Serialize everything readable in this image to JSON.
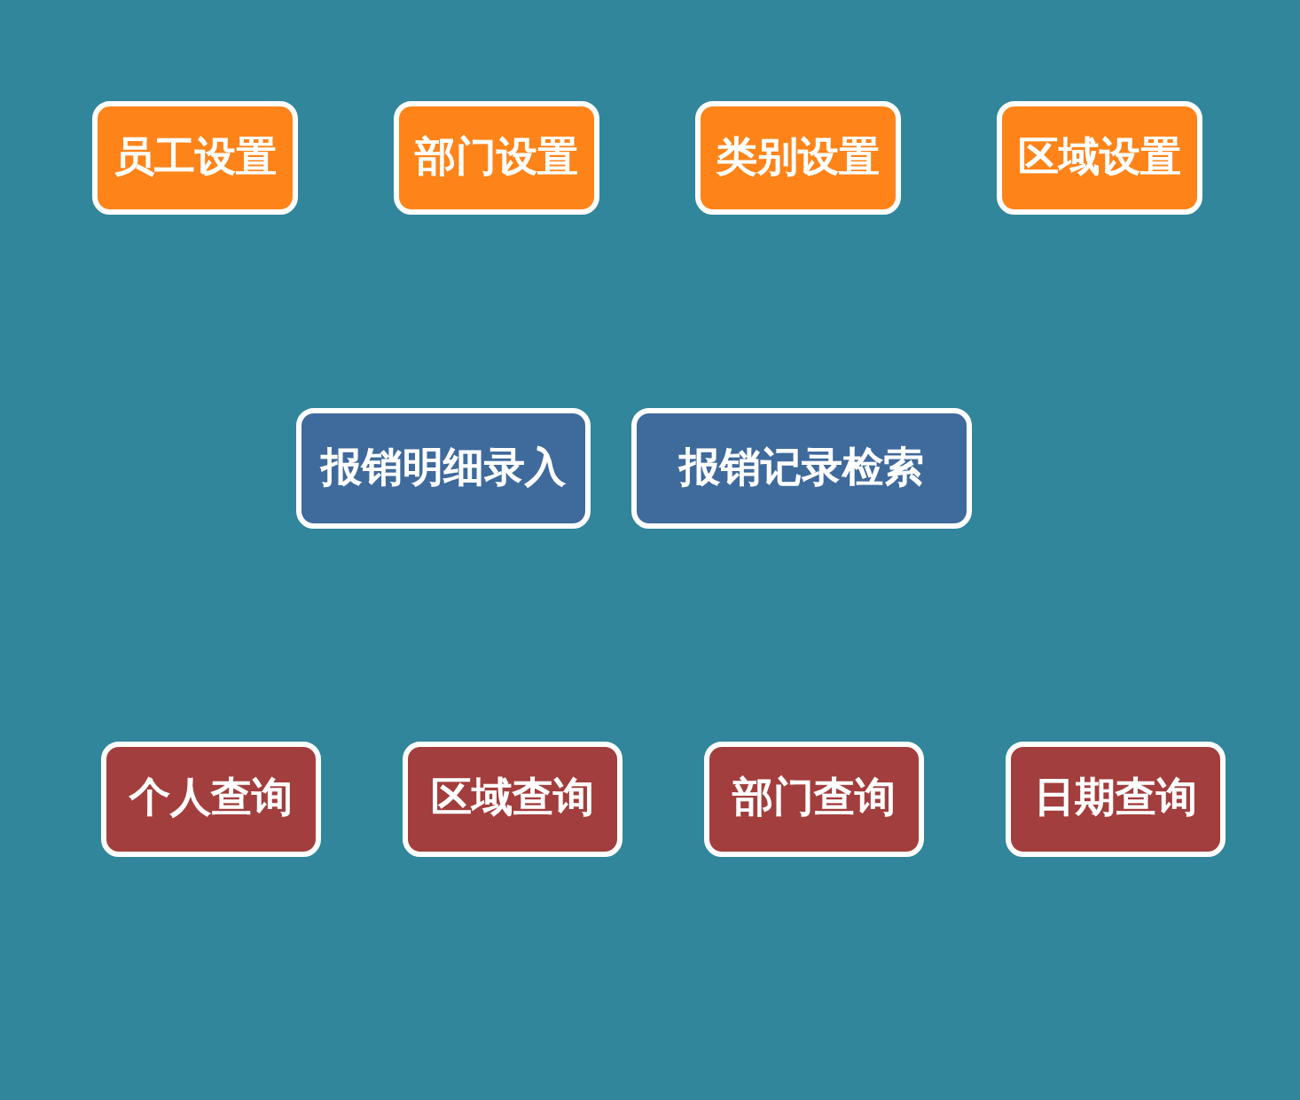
{
  "sections": [
    {
      "kind": "settings",
      "buttons": [
        "员工设置",
        "部门设置",
        "类别设置",
        "区域设置"
      ]
    },
    {
      "kind": "entry",
      "buttons": [
        "报销明细录入",
        "报销记录检索"
      ]
    },
    {
      "kind": "query",
      "buttons": [
        "个人查询",
        "区域查询",
        "部门查询",
        "日期查询"
      ]
    }
  ]
}
